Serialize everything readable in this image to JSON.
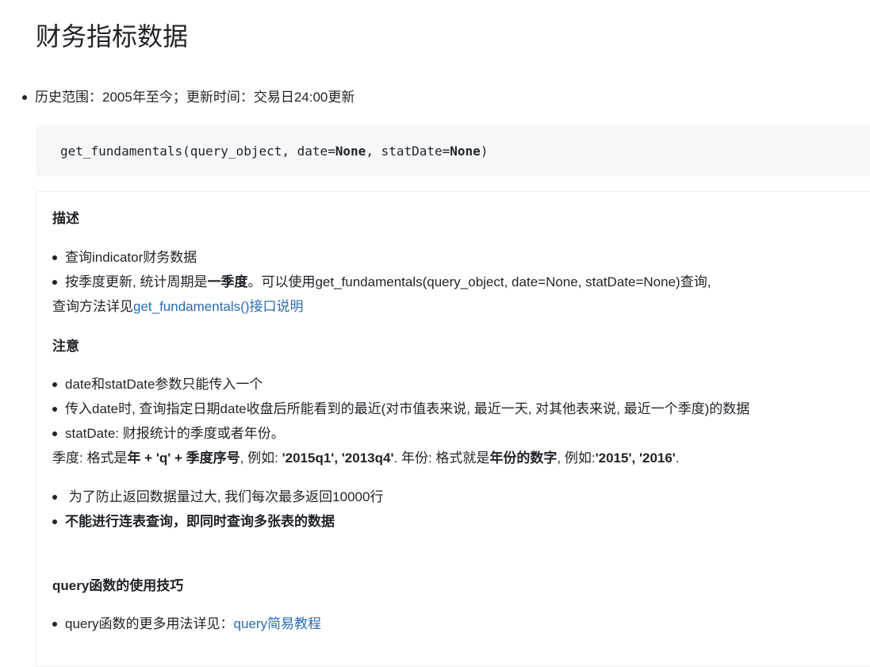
{
  "page": {
    "title": "财务指标数据",
    "history": "历史范围：2005年至今；更新时间：交易日24:00更新"
  },
  "code": {
    "prefix": "get_fundamentals(query_object, date=",
    "kw1": "None",
    "middle": ", statDate=",
    "kw2": "None",
    "suffix": ")"
  },
  "description": {
    "heading": "描述",
    "item1": "查询indicator财务数据",
    "item2_pre": "按季度更新, 统计周期是",
    "item2_bold": "一季度",
    "item2_post": "。可以使用get_fundamentals(query_object, date=None, statDate=None)查询,",
    "detail_pre": "查询方法详见",
    "detail_link": "get_fundamentals()接口说明"
  },
  "notice": {
    "heading": "注意",
    "item1": "date和statDate参数只能传入一个",
    "item2": "传入date时, 查询指定日期date收盘后所能看到的最近(对市值表来说, 最近一天, 对其他表来说, 最近一个季度)的数据",
    "item3": "statDate: 财报统计的季度或者年份。",
    "season_a": "季度: 格式是",
    "season_b": "年 + 'q' + 季度序号",
    "season_c": ", 例如: ",
    "season_d": "'2015q1', '2013q4'",
    "season_e": ". 年份: 格式就是",
    "season_f": "年份的数字",
    "season_g": ", 例如:",
    "season_h": "'2015', '2016'",
    "season_i": ".",
    "item4": " 为了防止返回数据量过大, 我们每次最多返回10000行",
    "item5": "不能进行连表查询，即同时查询多张表的数据"
  },
  "query_tips": {
    "heading": "query函数的使用技巧",
    "item1_pre": "query函数的更多用法详见：",
    "item1_link": "query简易教程"
  },
  "colors": {
    "text": "#1f2329",
    "link": "#2b6cb0",
    "code_bg": "#f6f7f8"
  }
}
